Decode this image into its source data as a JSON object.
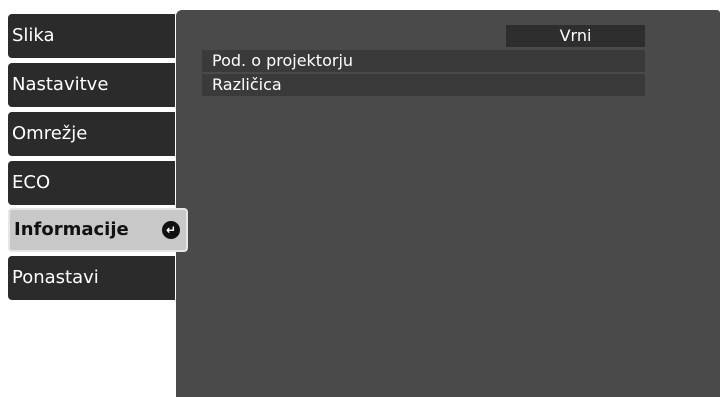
{
  "menu": {
    "items": [
      {
        "label": "Slika"
      },
      {
        "label": "Nastavitve"
      },
      {
        "label": "Omrežje"
      },
      {
        "label": "ECO"
      },
      {
        "label": "Informacije",
        "selected": true,
        "icon": "enter-icon"
      },
      {
        "label": "Ponastavi"
      }
    ]
  },
  "panel": {
    "back_label": "Vrni",
    "rows": [
      {
        "label": "Pod. o projektorju"
      },
      {
        "label": "Različica"
      }
    ]
  },
  "colors": {
    "menu_bg": "#2b2b2b",
    "menu_selected_bg": "#c8c8c8",
    "panel_bg": "#4a4a4a",
    "row_bg": "#3a3a3a",
    "back_bg": "#2e2e2e"
  }
}
